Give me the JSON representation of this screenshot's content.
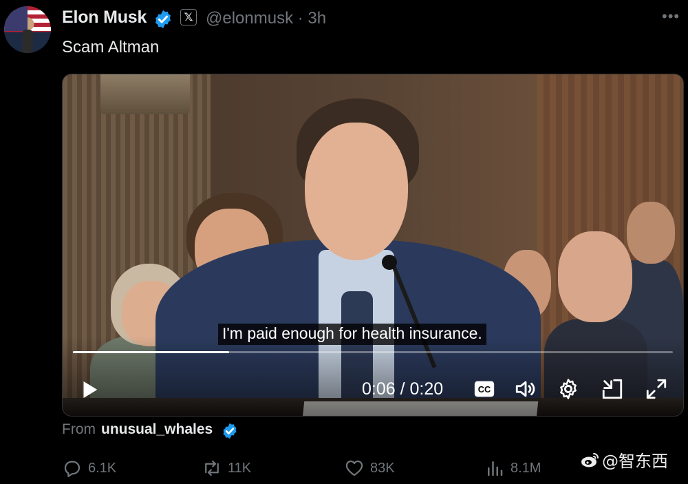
{
  "tweet": {
    "author_name": "Elon Musk",
    "handle_time": "@elonmusk · 3h",
    "text": "Scam Altman",
    "more_label": "•••",
    "x_badge": "𝕏"
  },
  "video": {
    "caption": "I'm paid enough for health insurance.",
    "time": "0:06 / 0:20",
    "progress": 0.26,
    "icons": [
      "play-icon",
      "cc-icon",
      "volume-icon",
      "settings-icon",
      "pip-icon",
      "fullscreen-icon"
    ]
  },
  "source": {
    "from_label": "From",
    "user": "unusual_whales"
  },
  "actions": {
    "replies": "6.1K",
    "reposts": "11K",
    "likes": "83K",
    "views": "8.1M"
  },
  "watermark": {
    "text": "@智东西"
  },
  "colors": {
    "background": "#000000",
    "text": "#e7e9ea",
    "muted": "#71767b",
    "verified": "#1d9bf0"
  }
}
